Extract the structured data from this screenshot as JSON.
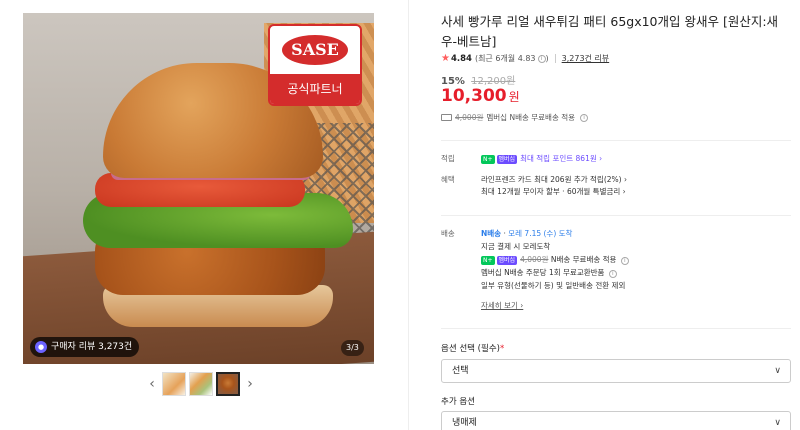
{
  "gallery": {
    "badge_brand": "SASE",
    "badge_text": "공식파트너",
    "review_badge": "구매자 리뷰 3,273건",
    "page_indicator": "3/3",
    "prev_arrow": "‹",
    "next_arrow": "›"
  },
  "product": {
    "title": "사세 빵가루 리얼 새우튀김 패티 65gx10개입 왕새우 [원산지:새우-베트남]",
    "rating": "4.84",
    "rating_detail": "(최근 6개월 4.83",
    "review_count": "3,273건 리뷰",
    "discount_pct": "15%",
    "original_price": "12,200원",
    "price": "10,300",
    "price_unit": "원",
    "shipping_strike": "4,000원",
    "shipping_text": "멤버십 N배송 무료배송 적용"
  },
  "benefits": {
    "points_label": "적립",
    "points_tag_n": "N+",
    "points_tag_member": "멤버십",
    "points_text": "최대 적립 포인트 861원 ›",
    "benefit_label": "혜택",
    "benefit_line1": "라인프렌즈 카드 최대 206원 추가 적립(2%) ›",
    "benefit_line2": "최대 12개월 무이자 할부 · 60개월 특별금리 ›"
  },
  "delivery": {
    "label": "배송",
    "chip": "N배송",
    "arrival": "모레 7.15 (수) 도착",
    "line1": "지금 결제 시 모레도착",
    "line2_strike": "4,000원",
    "line2": "N배송 무료배송 적용",
    "line3": "멤버십 N배송 주문당 1회 무료교환반품",
    "line4": "일부 유형(선물하기 등) 및 일반배송 전환 제외",
    "detail_link": "자세히 보기 ›"
  },
  "options": {
    "option_label": "옵션 선택 (필수)",
    "option_required_mark": "*",
    "option_value": "선택",
    "extra_label": "추가 옵션",
    "extra_value": "냉매제"
  },
  "colors": {
    "price_red": "#e61e2b",
    "sase_red": "#d42c2c",
    "star": "#ff5f5f",
    "npay_green": "#03c75a",
    "membership_purple": "#6c4cff",
    "delivery_blue": "#2b7de9"
  }
}
